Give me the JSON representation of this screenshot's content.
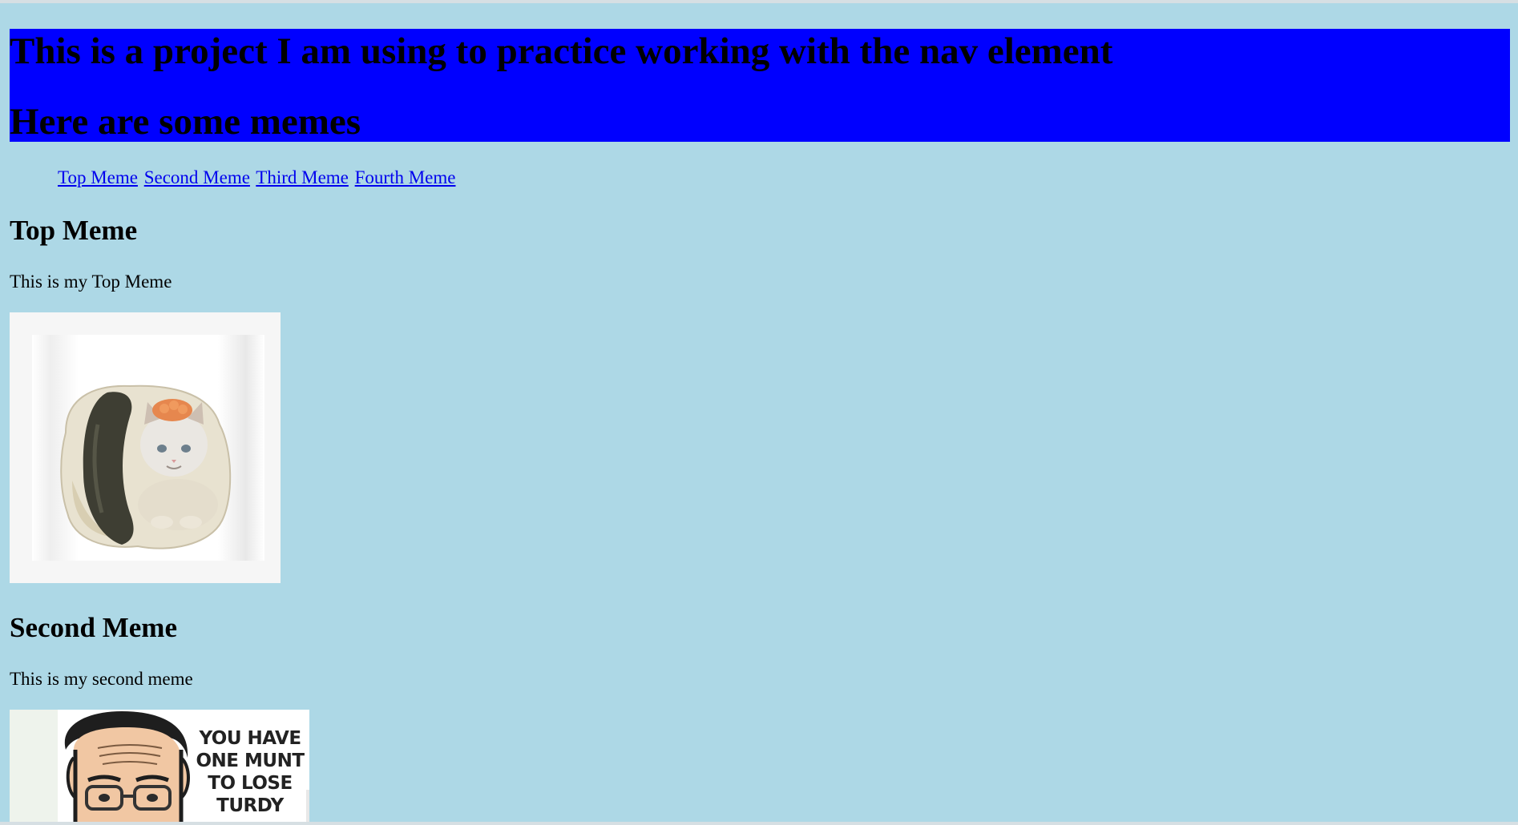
{
  "header": {
    "title_line1": "This is a project I am using to practice working with the nav element",
    "title_line2": "Here are some memes"
  },
  "nav": {
    "links": [
      "Top Meme",
      "Second Meme",
      "Third Meme",
      "Fourth Meme"
    ]
  },
  "sections": [
    {
      "heading": "Top Meme",
      "caption": "This is my Top Meme",
      "image": "cat-sushi-meme"
    },
    {
      "heading": "Second Meme",
      "caption": "This is my second meme",
      "image": "cartoon-man-meme",
      "image_text": [
        "YOU HAVE",
        "ONE MUNT",
        "TO LOSE",
        "TURDY"
      ]
    }
  ],
  "colors": {
    "page_background": "#add8e6",
    "header_background": "#0000ff",
    "link": "#0000ee"
  }
}
